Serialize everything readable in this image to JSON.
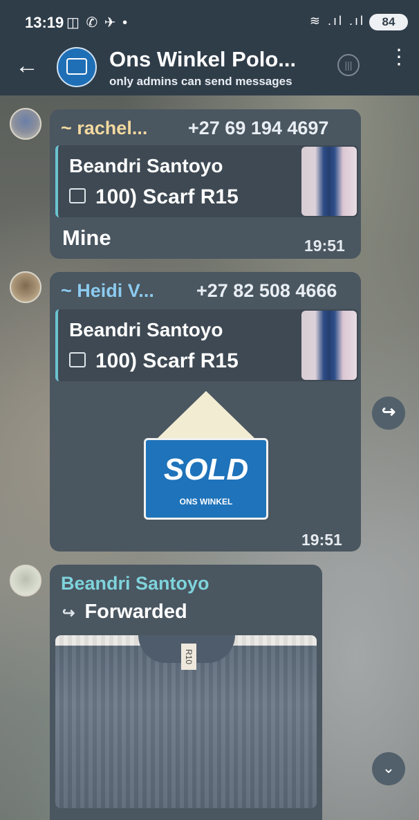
{
  "status_bar": {
    "time": "13:19",
    "left_icons": "◫ ✆ ✈ •",
    "right_icons": "≋ .ıl .ıl",
    "battery": "84"
  },
  "header": {
    "back_glyph": "←",
    "title": "Ons Winkel Polo...",
    "subtitle": "only admins can send messages",
    "voice_chat_glyph": "|||",
    "more_glyph": "⋮"
  },
  "messages": [
    {
      "sender": "~ rachel...",
      "sender_color": "#f3d9a0",
      "phone": "+27 69 194 4697",
      "reply_to": {
        "name": "Beandri Santoyo",
        "text": "100) Scarf R15"
      },
      "text": "Mine",
      "time": "19:51"
    },
    {
      "sender": "~ Heidi V...",
      "sender_color": "#8ccbf0",
      "phone": "+27 82 508 4666",
      "reply_to": {
        "name": "Beandri Santoyo",
        "text": "100) Scarf R15"
      },
      "sticker": {
        "main": "SOLD",
        "brand": "ONS WINKEL"
      },
      "time": "19:51"
    },
    {
      "sender": "Beandri Santoyo",
      "sender_color": "#7fd3db",
      "forwarded_label": "Forwarded",
      "forwarded_glyph": "↪",
      "photo_tag": "R10"
    }
  ],
  "buttons": {
    "forward_glyph": "↪",
    "scroll_down_glyph": "⌄"
  }
}
